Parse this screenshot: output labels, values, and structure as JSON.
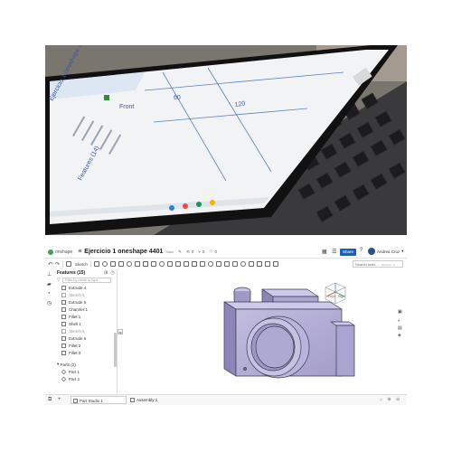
{
  "photo": {
    "screen_text": {
      "title": "Ejercicio 1 oneshape 4401",
      "features": "Features (14)",
      "front": "Front",
      "dim_top": "120",
      "dim_side": "60"
    }
  },
  "app": {
    "logo_text": "onshape",
    "doc_title": "Ejercicio 1 oneshape 4401",
    "workspace": "Main",
    "versions_count": "0",
    "branches_count": "0",
    "likes_count": "0",
    "share_label": "Share",
    "user_name": "Andrea Cruz",
    "sketch_label": "Sketch",
    "search_tools_placeholder": "Search tools...",
    "search_tools_shortcut": "alt/option C",
    "features_title": "Features (15)",
    "filter_placeholder": "Filter by name or type",
    "features": [
      {
        "name": "Extrude 4",
        "type": "feature"
      },
      {
        "name": "Sketch 5",
        "type": "sketch"
      },
      {
        "name": "Extrude 5",
        "type": "feature"
      },
      {
        "name": "Chamfer 1",
        "type": "feature"
      },
      {
        "name": "Fillet 1",
        "type": "feature"
      },
      {
        "name": "Shell 1",
        "type": "feature"
      },
      {
        "name": "Sketch 6",
        "type": "sketch"
      },
      {
        "name": "Extrude 6",
        "type": "feature"
      },
      {
        "name": "Fillet 2",
        "type": "feature"
      },
      {
        "name": "Fillet 3",
        "type": "feature"
      }
    ],
    "parts_title": "Parts (2)",
    "parts": [
      "Part 1",
      "Part 2"
    ],
    "tabs": [
      {
        "label": "Part Studio 1",
        "active": true
      },
      {
        "label": "Assembly 1",
        "active": false
      }
    ],
    "viewcube_labels": {
      "top": "Top",
      "front": "Front",
      "right": "Right"
    },
    "colors": {
      "model": "#b3aed2",
      "model_dark": "#7f79a8",
      "share": "#1d5fb4",
      "logo": "#3fa34d"
    }
  }
}
